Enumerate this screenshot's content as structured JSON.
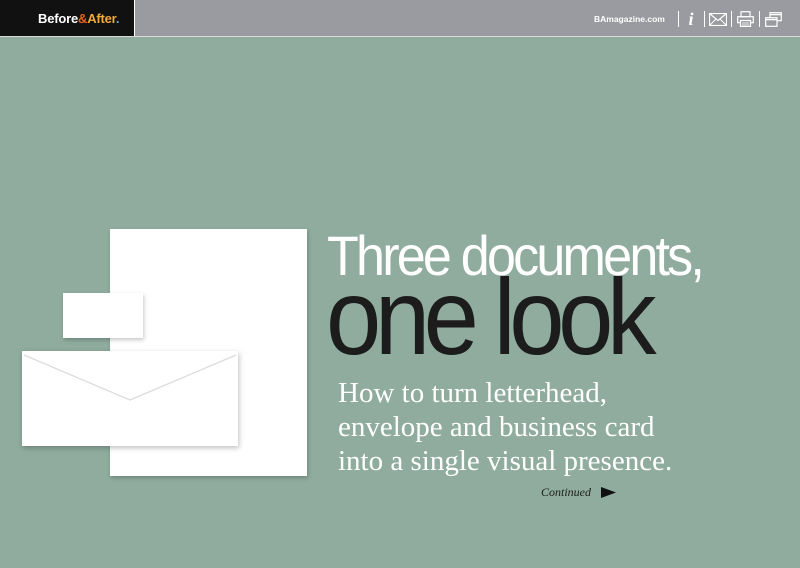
{
  "header": {
    "logo": {
      "before": "Before",
      "amp": "&",
      "after": "After",
      "dot": "."
    },
    "site_link": "BAmagazine.com",
    "icons": [
      "info-icon",
      "email-icon",
      "print-icon",
      "window-icon"
    ]
  },
  "article": {
    "headline_line1": "Three documents,",
    "headline_line2": "one look",
    "subhead_lines": [
      "How to turn letterhead,",
      "envelope and business card",
      "into a single visual presence."
    ],
    "continue_label": "Continued"
  },
  "colors": {
    "background": "#8fac9e",
    "topbar": "#9a9ba0",
    "logo_bg": "#111111",
    "headline_dark": "#1c1c1c",
    "paper": "#ffffff"
  }
}
